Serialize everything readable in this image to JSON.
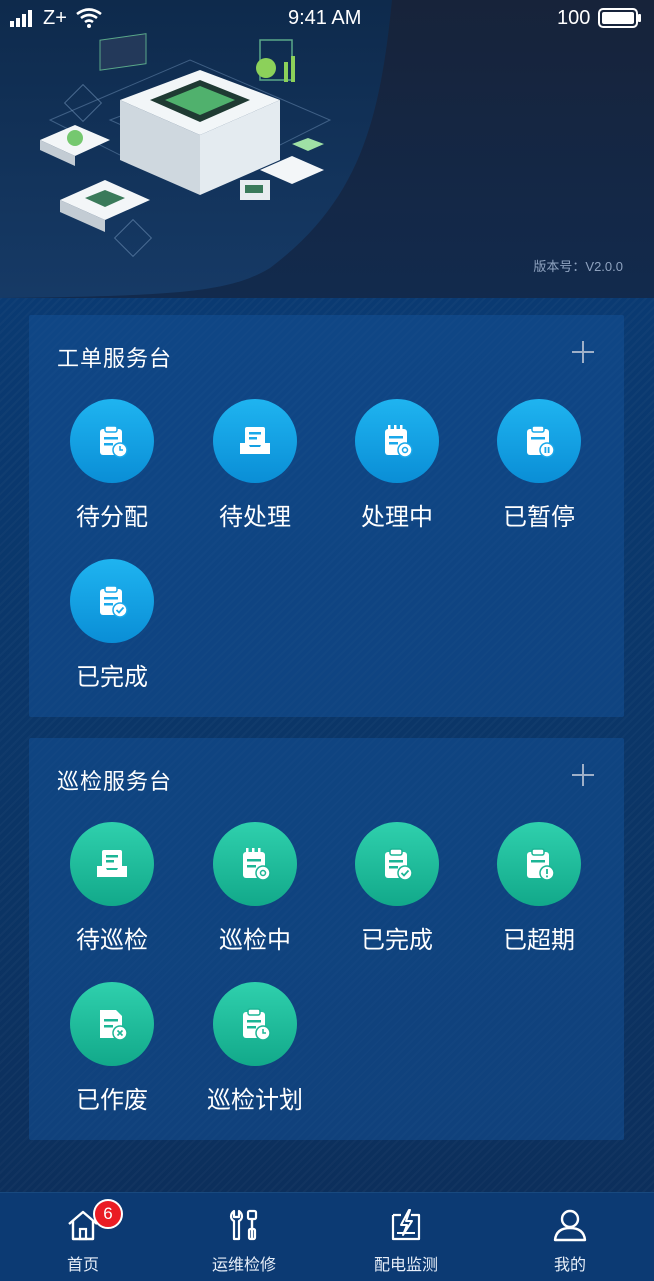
{
  "status_bar": {
    "carrier": "Z+",
    "time": "9:41 AM",
    "battery": "100"
  },
  "header": {
    "version": "版本号：V2.0.0"
  },
  "work_order": {
    "title": "工单服务台",
    "items": [
      {
        "label": "待分配",
        "icon": "clipboard-clock-icon"
      },
      {
        "label": "待处理",
        "icon": "inbox-tray-icon"
      },
      {
        "label": "处理中",
        "icon": "notepad-gear-icon"
      },
      {
        "label": "已暂停",
        "icon": "clipboard-pause-icon"
      },
      {
        "label": "已完成",
        "icon": "clipboard-check-icon"
      }
    ]
  },
  "inspection": {
    "title": "巡检服务台",
    "items": [
      {
        "label": "待巡检",
        "icon": "inbox-tray-icon"
      },
      {
        "label": "巡检中",
        "icon": "notepad-gear-icon"
      },
      {
        "label": "已完成",
        "icon": "clipboard-check-icon"
      },
      {
        "label": "已超期",
        "icon": "clipboard-alert-icon"
      },
      {
        "label": "已作废",
        "icon": "document-x-icon"
      },
      {
        "label": "巡检计划",
        "icon": "clipboard-clock-icon"
      }
    ]
  },
  "bottom_nav": {
    "items": [
      {
        "label": "首页",
        "icon": "home-icon",
        "badge": "6"
      },
      {
        "label": "运维检修",
        "icon": "tools-icon"
      },
      {
        "label": "配电监测",
        "icon": "power-monitor-icon"
      },
      {
        "label": "我的",
        "icon": "user-icon"
      }
    ]
  },
  "colors": {
    "blue_circle": "#1aa8ea",
    "green_circle": "#22bf9c",
    "badge": "#ea1c24",
    "background": "#0c2a55"
  }
}
